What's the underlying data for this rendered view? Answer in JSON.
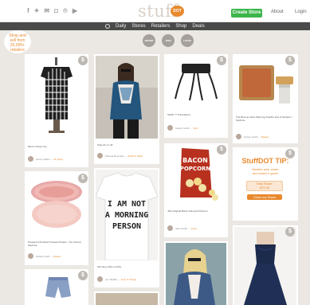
{
  "header": {
    "social_icons": [
      "facebook-icon",
      "twitter-icon",
      "email-icon",
      "instagram-icon",
      "pinterest-icon",
      "youtube-icon"
    ],
    "social_glyphs": [
      "f",
      "✦",
      "✉",
      "◘",
      "℗",
      "▶"
    ],
    "logo_text": "stuff",
    "logo_dot_text": "DOT",
    "create_store": "Create Store",
    "about": "About",
    "login": "Login"
  },
  "nav": {
    "items": [
      "Daily",
      "Stores",
      "Retailers",
      "Shop",
      "Deals"
    ]
  },
  "filters": [
    "BRAND",
    "JOIN",
    "LOGIN"
  ],
  "promo_badge": {
    "lines": [
      "Shop and",
      "sell from",
      "20,000+",
      "retailers"
    ]
  },
  "cards": {
    "blouse": {
      "caption": "Mimi's Chaos Top",
      "user": "Jenny Collins",
      "store": "My Style"
    },
    "fashion": {
      "caption": "Style #1 on Jill",
      "user": "Pamela Reynolds",
      "store": "What To Wear"
    },
    "tablestand": {
      "caption": "TabFit ™ PrimeStand",
      "user": "Kelsey Smith",
      "store": "Tech"
    },
    "bronzer": {
      "caption": "The Bronzer Glow Warming Powder Duo & Sculptor | Sephora",
      "user": "Kelsey Smith",
      "store": "Beauty"
    },
    "powder": {
      "caption": "Pressed & Finished Pressed Powder - Too Faced | Sephora",
      "user": "Kelsey Smith",
      "store": "Beauty"
    },
    "tshirt": {
      "caption": "Morning coffee (t-shirt)",
      "user": "Jen Shaffer",
      "store": "Tees & Things"
    },
    "popcorn": {
      "caption": "J&G Original Bacon Flavored Popcorn",
      "user": "Allen Smith",
      "store": "Food"
    },
    "tip": {
      "title": "StuffDOT TIP:",
      "line1": "Monitor your share",
      "line2": "and watch it grow!",
      "total_label": "Total Share:",
      "total_value": "$75.30",
      "button": "Claim my Share"
    }
  },
  "price_badge": "$",
  "colors": {
    "accent_orange": "#e8892e",
    "create_green": "#3bb54a",
    "nav_dark": "#4a4a4a",
    "background": "#ebe8e4"
  }
}
